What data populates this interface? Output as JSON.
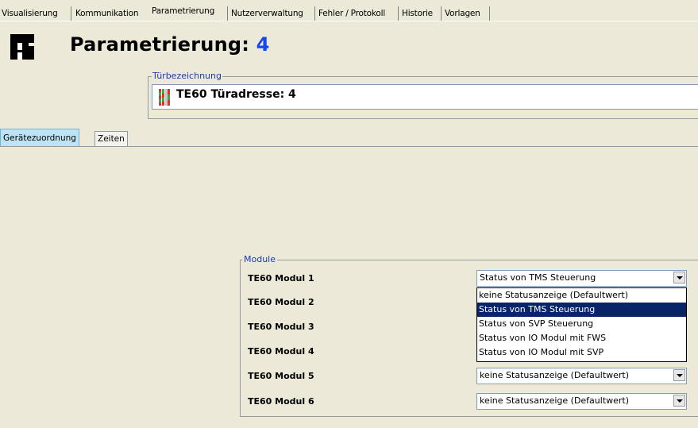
{
  "top_tabs": [
    {
      "label": "Visualisierung"
    },
    {
      "label": "Kommunikation"
    },
    {
      "label": "Parametrierung"
    },
    {
      "label": "Nutzerverwaltung"
    },
    {
      "label": "Fehler / Protokoll"
    },
    {
      "label": "Historie"
    },
    {
      "label": "Vorlagen"
    }
  ],
  "header": {
    "title": "Parametrierung:",
    "number": "4"
  },
  "door": {
    "legend": "Türbezeichnung",
    "text": "TE60   Türadresse: 4"
  },
  "sub_tabs": [
    {
      "label": "Gerätezuordnung"
    },
    {
      "label": "Zeiten"
    }
  ],
  "modules": {
    "legend": "Module",
    "rows": [
      {
        "label": "TE60 Modul 1",
        "value": "Status von TMS Steuerung"
      },
      {
        "label": "TE60 Modul 2"
      },
      {
        "label": "TE60 Modul 3"
      },
      {
        "label": "TE60 Modul 4"
      },
      {
        "label": "TE60 Modul 5",
        "value": "keine Statusanzeige (Defaultwert)"
      },
      {
        "label": "TE60 Modul 6",
        "value": "keine Statusanzeige (Defaultwert)"
      }
    ],
    "dropdown_options": [
      "keine Statusanzeige (Defaultwert)",
      "Status von TMS Steuerung",
      "Status von SVP Steuerung",
      "Status von IO Modul mit FWS",
      "Status von IO Modul mit SVP"
    ],
    "dropdown_selected": "Status von TMS Steuerung"
  },
  "colors": {
    "title_number": "#1747E6",
    "selection": "#0A246A",
    "active_subtab": "#BDE3F5",
    "legend": "#1A3CA8"
  }
}
